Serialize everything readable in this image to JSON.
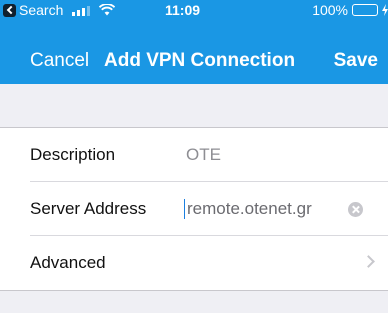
{
  "status_bar": {
    "back_app": "Search",
    "time": "11:09",
    "battery": "100%",
    "battery_level": 1.0,
    "icons": [
      "back-arrow-icon",
      "signal-icon",
      "wifi-icon",
      "battery-icon",
      "charging-icon"
    ]
  },
  "nav": {
    "cancel_label": "Cancel",
    "title": "Add VPN Connection",
    "save_label": "Save"
  },
  "form": {
    "description": {
      "label": "Description",
      "value": "OTE"
    },
    "server": {
      "label": "Server Address",
      "value": "remote.otenet.gr"
    },
    "advanced": {
      "label": "Advanced"
    }
  },
  "colors": {
    "header": "#1a97e4",
    "background": "#efeff4",
    "battery_fill": "#4cd964"
  }
}
